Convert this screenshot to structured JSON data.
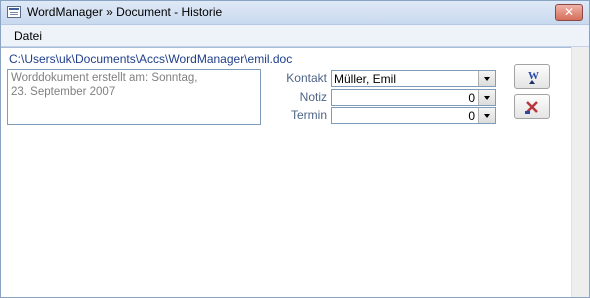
{
  "window": {
    "title": "WordManager » Document - Historie",
    "close_glyph": "✕"
  },
  "menu": {
    "items": [
      "Datei"
    ]
  },
  "document": {
    "path": "C:\\Users\\uk\\Documents\\Accs\\WordManager\\emil.doc",
    "info_line1": "Worddokument erstellt am: Sonntag,",
    "info_line2": "23. September 2007"
  },
  "form": {
    "kontakt_label": "Kontakt",
    "kontakt_value": "Müller, Emil",
    "notiz_label": "Notiz",
    "notiz_value": "0",
    "termin_label": "Termin",
    "termin_value": "0"
  },
  "icons": {
    "open_word": "word-document-icon",
    "delete": "delete-x-icon"
  },
  "colors": {
    "path_text": "#1f3f8a",
    "label_text": "#4e6486",
    "word_blue": "#2b4aa8",
    "delete_red": "#b5373a"
  }
}
